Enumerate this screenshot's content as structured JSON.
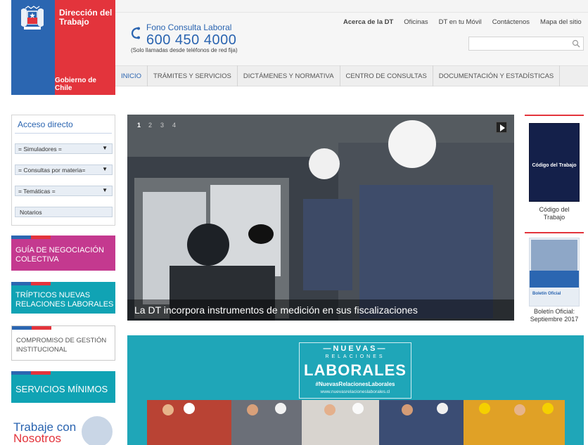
{
  "logo": {
    "title_line1": "Dirección del",
    "title_line2": "Trabajo",
    "subtitle": "Gobierno de Chile",
    "icon": "chile-coat-of-arms-icon",
    "colors": {
      "blue": "#2b66b1",
      "red": "#e3343c"
    }
  },
  "phone": {
    "icon": "phone-icon",
    "label": "Fono Consulta Laboral",
    "number": "600 450 4000",
    "note": "(Solo llamadas desde teléfonos de red fija)"
  },
  "top_links": [
    "Acerca de la DT",
    "Oficinas",
    "DT en tu Móvil",
    "Contáctenos",
    "Mapa del sitio"
  ],
  "search": {
    "placeholder": "",
    "icon": "search-icon"
  },
  "nav": [
    "INICIO",
    "TRÁMITES Y SERVICIOS",
    "DICTÁMENES Y NORMATIVA",
    "CENTRO DE CONSULTAS",
    "DOCUMENTACIÓN Y ESTADÍSTICAS"
  ],
  "sidebar": {
    "acceso_title": "Acceso directo",
    "selects": [
      "= Simuladores =",
      "= Consultas por materia=",
      "= Temáticas ="
    ],
    "notarios": "Notarios",
    "promos": {
      "guia": [
        "GUÍA DE NEGOCIACIÓN",
        "COLECTIVA"
      ],
      "tripticos": [
        "TRÍPTICOS NUEVAS",
        "RELACIONES LABORALES"
      ],
      "compromiso": [
        "COMPROMISO DE GESTIÓN",
        "INSTITUCIONAL"
      ],
      "servicios": "SERVICIOS MÍNIMOS"
    },
    "trabaje": [
      "Trabaje con",
      "Nosotros"
    ]
  },
  "slider": {
    "pages": [
      "1",
      "2",
      "3",
      "4"
    ],
    "active_page": "1",
    "caption": "La DT incorpora instrumentos de medición en sus fiscalizaciones",
    "play_icon": "play-icon"
  },
  "right_col": {
    "codigo_book_title": "Código del Trabajo",
    "codigo_label": [
      "Código del",
      "Trabajo"
    ],
    "boletin_img_text": "Boletín Oficial",
    "boletin_label": [
      "Boletín Oficial:",
      "Septiembre 2017"
    ]
  },
  "banner": {
    "line1": "—NUEVAS—",
    "line2": "RELACIONES",
    "line3": "LABORALES",
    "hashtag": "#NuevasRelacionesLaborales",
    "url": "www.nuevasrelacioneslaborales.cl",
    "bg_color": "#1fa6b8"
  }
}
